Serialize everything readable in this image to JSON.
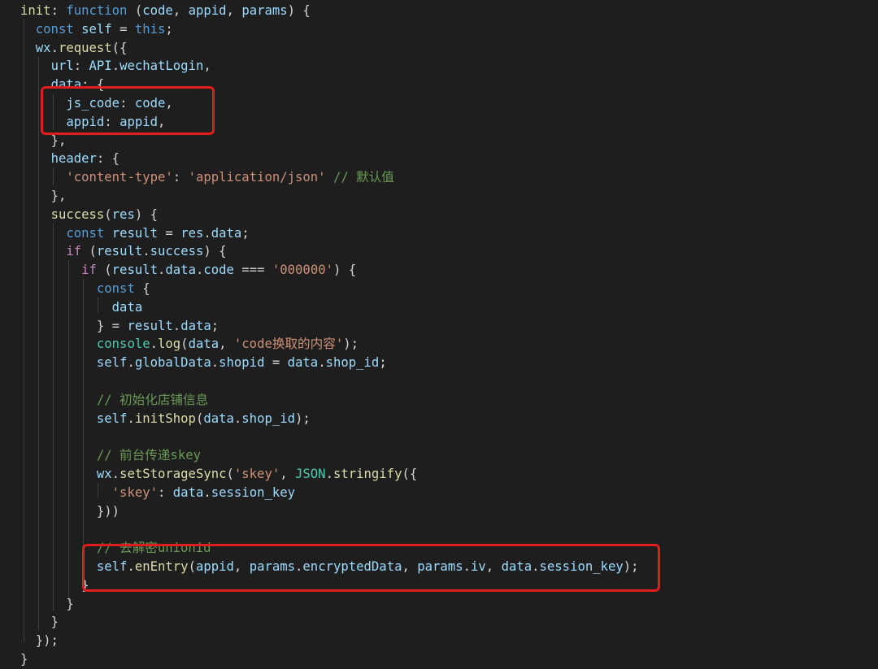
{
  "colors": {
    "background": "#1e1e1e",
    "keyword_blue": "#569cd6",
    "keyword_purple": "#c586c0",
    "function_yellow": "#dcdcaa",
    "variable": "#9cdcfe",
    "string": "#ce9178",
    "comment": "#6a9955",
    "class": "#4ec9b0",
    "highlight_box": "#e21c1c"
  },
  "code": {
    "lines": [
      {
        "tokens": [
          [
            "init",
            "fn"
          ],
          [
            ": ",
            "pu"
          ],
          [
            "function",
            "k1"
          ],
          [
            " (",
            "pu"
          ],
          [
            "code",
            "va"
          ],
          [
            ", ",
            "pu"
          ],
          [
            "appid",
            "va"
          ],
          [
            ", ",
            "pu"
          ],
          [
            "params",
            "va"
          ],
          [
            ") {",
            "pu"
          ]
        ]
      },
      {
        "tokens": [
          [
            "  ",
            "pu"
          ],
          [
            "const",
            "k1"
          ],
          [
            " ",
            "pu"
          ],
          [
            "self",
            "va"
          ],
          [
            " = ",
            "pu"
          ],
          [
            "this",
            "k1"
          ],
          [
            ";",
            "pu"
          ]
        ]
      },
      {
        "tokens": [
          [
            "  ",
            "pu"
          ],
          [
            "wx",
            "va"
          ],
          [
            ".",
            "pu"
          ],
          [
            "request",
            "fn"
          ],
          [
            "({",
            "pu"
          ]
        ]
      },
      {
        "tokens": [
          [
            "    ",
            "pu"
          ],
          [
            "url",
            "pr"
          ],
          [
            ": ",
            "pu"
          ],
          [
            "API",
            "va"
          ],
          [
            ".",
            "pu"
          ],
          [
            "wechatLogin",
            "pr"
          ],
          [
            ",",
            "pu"
          ]
        ]
      },
      {
        "tokens": [
          [
            "    ",
            "pu"
          ],
          [
            "data",
            "pr"
          ],
          [
            ": {",
            "pu"
          ]
        ]
      },
      {
        "tokens": [
          [
            "      ",
            "pu"
          ],
          [
            "js_code",
            "pr"
          ],
          [
            ": ",
            "pu"
          ],
          [
            "code",
            "va"
          ],
          [
            ",",
            "pu"
          ]
        ]
      },
      {
        "tokens": [
          [
            "      ",
            "pu"
          ],
          [
            "appid",
            "pr"
          ],
          [
            ": ",
            "pu"
          ],
          [
            "appid",
            "va"
          ],
          [
            ",",
            "pu"
          ]
        ]
      },
      {
        "tokens": [
          [
            "    ",
            "pu"
          ],
          [
            "},",
            "pu"
          ]
        ]
      },
      {
        "tokens": [
          [
            "    ",
            "pu"
          ],
          [
            "header",
            "pr"
          ],
          [
            ": {",
            "pu"
          ]
        ]
      },
      {
        "tokens": [
          [
            "      ",
            "pu"
          ],
          [
            "'content-type'",
            "st"
          ],
          [
            ": ",
            "pu"
          ],
          [
            "'application/json'",
            "st"
          ],
          [
            " ",
            "pu"
          ],
          [
            "// 默认值",
            "cm"
          ]
        ]
      },
      {
        "tokens": [
          [
            "    ",
            "pu"
          ],
          [
            "},",
            "pu"
          ]
        ]
      },
      {
        "tokens": [
          [
            "    ",
            "pu"
          ],
          [
            "success",
            "fn"
          ],
          [
            "(",
            "pu"
          ],
          [
            "res",
            "va"
          ],
          [
            ") {",
            "pu"
          ]
        ]
      },
      {
        "tokens": [
          [
            "      ",
            "pu"
          ],
          [
            "const",
            "k1"
          ],
          [
            " ",
            "pu"
          ],
          [
            "result",
            "va"
          ],
          [
            " = ",
            "pu"
          ],
          [
            "res",
            "va"
          ],
          [
            ".",
            "pu"
          ],
          [
            "data",
            "pr"
          ],
          [
            ";",
            "pu"
          ]
        ]
      },
      {
        "tokens": [
          [
            "      ",
            "pu"
          ],
          [
            "if",
            "k2"
          ],
          [
            " (",
            "pu"
          ],
          [
            "result",
            "va"
          ],
          [
            ".",
            "pu"
          ],
          [
            "success",
            "pr"
          ],
          [
            ") {",
            "pu"
          ]
        ]
      },
      {
        "tokens": [
          [
            "        ",
            "pu"
          ],
          [
            "if",
            "k2"
          ],
          [
            " (",
            "pu"
          ],
          [
            "result",
            "va"
          ],
          [
            ".",
            "pu"
          ],
          [
            "data",
            "pr"
          ],
          [
            ".",
            "pu"
          ],
          [
            "code",
            "pr"
          ],
          [
            " === ",
            "pu"
          ],
          [
            "'000000'",
            "st"
          ],
          [
            ") {",
            "pu"
          ]
        ]
      },
      {
        "tokens": [
          [
            "          ",
            "pu"
          ],
          [
            "const",
            "k1"
          ],
          [
            " {",
            "pu"
          ]
        ]
      },
      {
        "tokens": [
          [
            "            ",
            "pu"
          ],
          [
            "data",
            "va"
          ]
        ]
      },
      {
        "tokens": [
          [
            "          ",
            "pu"
          ],
          [
            "} = ",
            "pu"
          ],
          [
            "result",
            "va"
          ],
          [
            ".",
            "pu"
          ],
          [
            "data",
            "pr"
          ],
          [
            ";",
            "pu"
          ]
        ]
      },
      {
        "tokens": [
          [
            "          ",
            "pu"
          ],
          [
            "console",
            "cl"
          ],
          [
            ".",
            "pu"
          ],
          [
            "log",
            "fn"
          ],
          [
            "(",
            "pu"
          ],
          [
            "data",
            "va"
          ],
          [
            ", ",
            "pu"
          ],
          [
            "'code换取的内容'",
            "st"
          ],
          [
            ");",
            "pu"
          ]
        ]
      },
      {
        "tokens": [
          [
            "          ",
            "pu"
          ],
          [
            "self",
            "va"
          ],
          [
            ".",
            "pu"
          ],
          [
            "globalData",
            "pr"
          ],
          [
            ".",
            "pu"
          ],
          [
            "shopid",
            "pr"
          ],
          [
            " = ",
            "pu"
          ],
          [
            "data",
            "va"
          ],
          [
            ".",
            "pu"
          ],
          [
            "shop_id",
            "pr"
          ],
          [
            ";",
            "pu"
          ]
        ]
      },
      {
        "tokens": [
          [
            "",
            "pu"
          ]
        ]
      },
      {
        "tokens": [
          [
            "          ",
            "pu"
          ],
          [
            "// 初始化店铺信息",
            "cm"
          ]
        ]
      },
      {
        "tokens": [
          [
            "          ",
            "pu"
          ],
          [
            "self",
            "va"
          ],
          [
            ".",
            "pu"
          ],
          [
            "initShop",
            "fn"
          ],
          [
            "(",
            "pu"
          ],
          [
            "data",
            "va"
          ],
          [
            ".",
            "pu"
          ],
          [
            "shop_id",
            "pr"
          ],
          [
            ");",
            "pu"
          ]
        ]
      },
      {
        "tokens": [
          [
            "",
            "pu"
          ]
        ]
      },
      {
        "tokens": [
          [
            "          ",
            "pu"
          ],
          [
            "// 前台传递skey",
            "cm"
          ]
        ]
      },
      {
        "tokens": [
          [
            "          ",
            "pu"
          ],
          [
            "wx",
            "va"
          ],
          [
            ".",
            "pu"
          ],
          [
            "setStorageSync",
            "fn"
          ],
          [
            "(",
            "pu"
          ],
          [
            "'skey'",
            "st"
          ],
          [
            ", ",
            "pu"
          ],
          [
            "JSON",
            "cl"
          ],
          [
            ".",
            "pu"
          ],
          [
            "stringify",
            "fn"
          ],
          [
            "({",
            "pu"
          ]
        ]
      },
      {
        "tokens": [
          [
            "            ",
            "pu"
          ],
          [
            "'skey'",
            "st"
          ],
          [
            ": ",
            "pu"
          ],
          [
            "data",
            "va"
          ],
          [
            ".",
            "pu"
          ],
          [
            "session_key",
            "pr"
          ]
        ]
      },
      {
        "tokens": [
          [
            "          ",
            "pu"
          ],
          [
            "}))",
            "pu"
          ]
        ]
      },
      {
        "tokens": [
          [
            "",
            "pu"
          ]
        ]
      },
      {
        "tokens": [
          [
            "          ",
            "pu"
          ],
          [
            "// 去解密unionid",
            "cm"
          ]
        ]
      },
      {
        "tokens": [
          [
            "          ",
            "pu"
          ],
          [
            "self",
            "va"
          ],
          [
            ".",
            "pu"
          ],
          [
            "enEntry",
            "fn"
          ],
          [
            "(",
            "pu"
          ],
          [
            "appid",
            "va"
          ],
          [
            ", ",
            "pu"
          ],
          [
            "params",
            "va"
          ],
          [
            ".",
            "pu"
          ],
          [
            "encryptedData",
            "pr"
          ],
          [
            ", ",
            "pu"
          ],
          [
            "params",
            "va"
          ],
          [
            ".",
            "pu"
          ],
          [
            "iv",
            "pr"
          ],
          [
            ", ",
            "pu"
          ],
          [
            "data",
            "va"
          ],
          [
            ".",
            "pu"
          ],
          [
            "session_key",
            "pr"
          ],
          [
            ");",
            "pu"
          ]
        ]
      },
      {
        "tokens": [
          [
            "        ",
            "pu"
          ],
          [
            "}",
            "pu"
          ]
        ]
      },
      {
        "tokens": [
          [
            "      ",
            "pu"
          ],
          [
            "}",
            "pu"
          ]
        ]
      },
      {
        "tokens": [
          [
            "    ",
            "pu"
          ],
          [
            "}",
            "pu"
          ]
        ]
      },
      {
        "tokens": [
          [
            "  ",
            "pu"
          ],
          [
            "});",
            "pu"
          ]
        ]
      },
      {
        "tokens": [
          [
            "}",
            "pu"
          ]
        ]
      }
    ]
  }
}
